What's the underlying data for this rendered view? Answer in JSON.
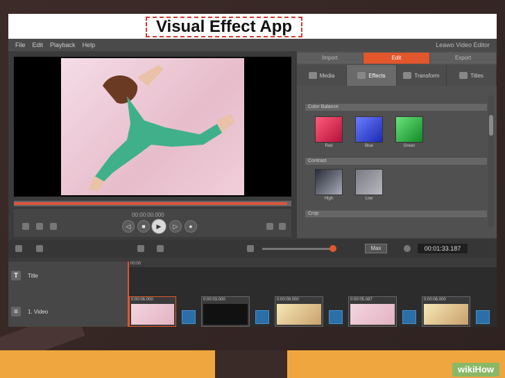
{
  "caption": "Visual Effect App",
  "menu": [
    "File",
    "Edit",
    "Playback",
    "Help"
  ],
  "app_name": "Leawo Video Editor",
  "top_tabs": [
    {
      "label": "Import",
      "active": false
    },
    {
      "label": "Edit",
      "active": true
    },
    {
      "label": "Export",
      "active": false
    }
  ],
  "sub_tabs": [
    {
      "label": "Media",
      "active": false
    },
    {
      "label": "Effects",
      "active": true
    },
    {
      "label": "Transform",
      "active": false
    },
    {
      "label": "Titles",
      "active": false
    }
  ],
  "sections": {
    "color_balance": "Color Balance",
    "contrast": "Contrast",
    "crop": "Crop"
  },
  "color_swatches": [
    {
      "label": "Red",
      "color": "#e23a5c"
    },
    {
      "label": "Blue",
      "color": "#3a56e6"
    },
    {
      "label": "Green",
      "color": "#39c34f"
    }
  ],
  "contrast_swatches": [
    {
      "label": "High",
      "color": "#666a77"
    },
    {
      "label": "Low",
      "color": "#9a9aa2"
    }
  ],
  "preview_time": "00:00:00.000",
  "max_label": "Max",
  "timecode": "00:01:33.187",
  "ruler_start": "00:00",
  "tracks": [
    {
      "label": "Title",
      "icon": "T"
    },
    {
      "label": "1. Video",
      "icon": "≡"
    }
  ],
  "clip_times": [
    "0:00:06.000",
    "0:00:03.000",
    "0:00:09.000",
    "0:00:05.087",
    "0:00:06.000"
  ],
  "accent_color": "#e2572c",
  "brand": "wikiHow"
}
